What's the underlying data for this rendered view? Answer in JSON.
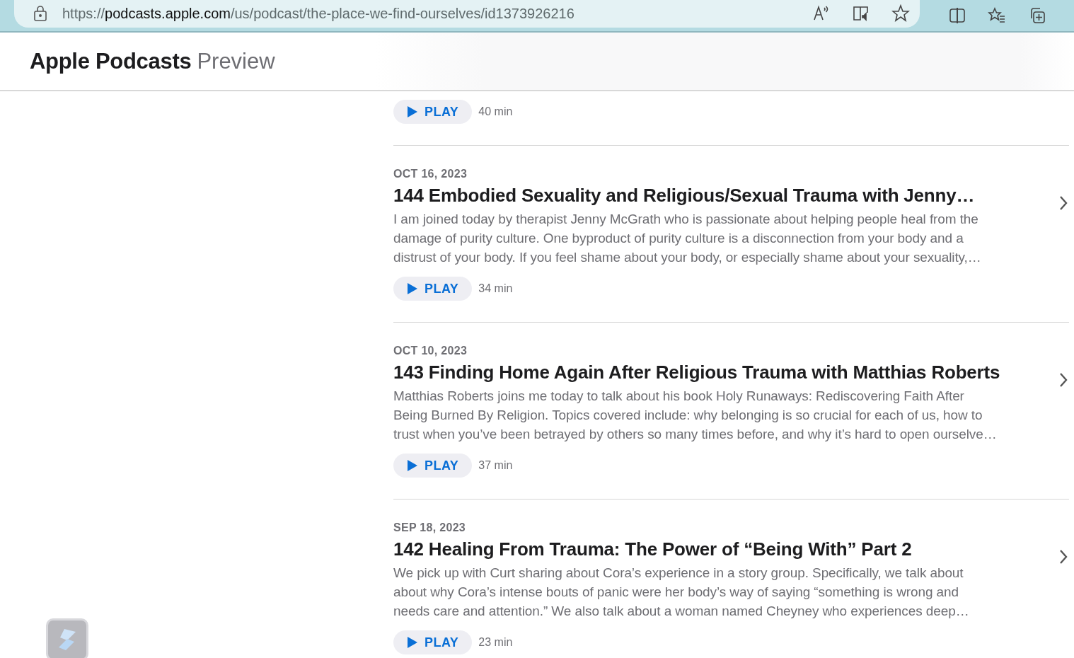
{
  "browser": {
    "url_prefix": "https://",
    "url_domain": "podcasts.apple.com",
    "url_path": "/us/podcast/the-place-we-find-ourselves/id1373926216"
  },
  "header": {
    "brand": "Apple Podcasts",
    "suffix": "Preview"
  },
  "first_episode": {
    "play_label": "PLAY",
    "duration": "40 min"
  },
  "episodes": [
    {
      "date": "OCT 16, 2023",
      "title": "144 Embodied Sexuality and Religious/Sexual Trauma with Jenny…",
      "description_lines": [
        "I am joined today by therapist Jenny McGrath who is passionate about helping people heal from the",
        "damage of purity culture. One byproduct of purity culture is a disconnection from your body and a",
        "distrust of your body. If you feel shame about your body, or especially shame about your sexuality,…"
      ],
      "play_label": "PLAY",
      "duration": "34 min"
    },
    {
      "date": "OCT 10, 2023",
      "title": "143 Finding Home Again After Religious Trauma with Matthias Roberts",
      "description_lines": [
        "Matthias Roberts joins me today to talk about his book Holy Runaways: Rediscovering Faith After",
        "Being Burned By Religion. Topics covered include: why belonging is so crucial for each of us, how to",
        "trust when you’ve been betrayed by others so many times before, and why it’s hard to open ourselve…"
      ],
      "play_label": "PLAY",
      "duration": "37 min"
    },
    {
      "date": "SEP 18, 2023",
      "title": "142 Healing From Trauma: The Power of “Being With” Part 2",
      "description_lines": [
        "We pick up with Curt sharing about Cora’s experience in a story group. Specifically, we talk about",
        "about why Cora’s intense bouts of panic were her body’s way of saying “something is wrong and",
        "needs care and attention.” We also talk about a woman named Cheyney who experiences deep…"
      ],
      "play_label": "PLAY",
      "duration": "23 min"
    }
  ]
}
